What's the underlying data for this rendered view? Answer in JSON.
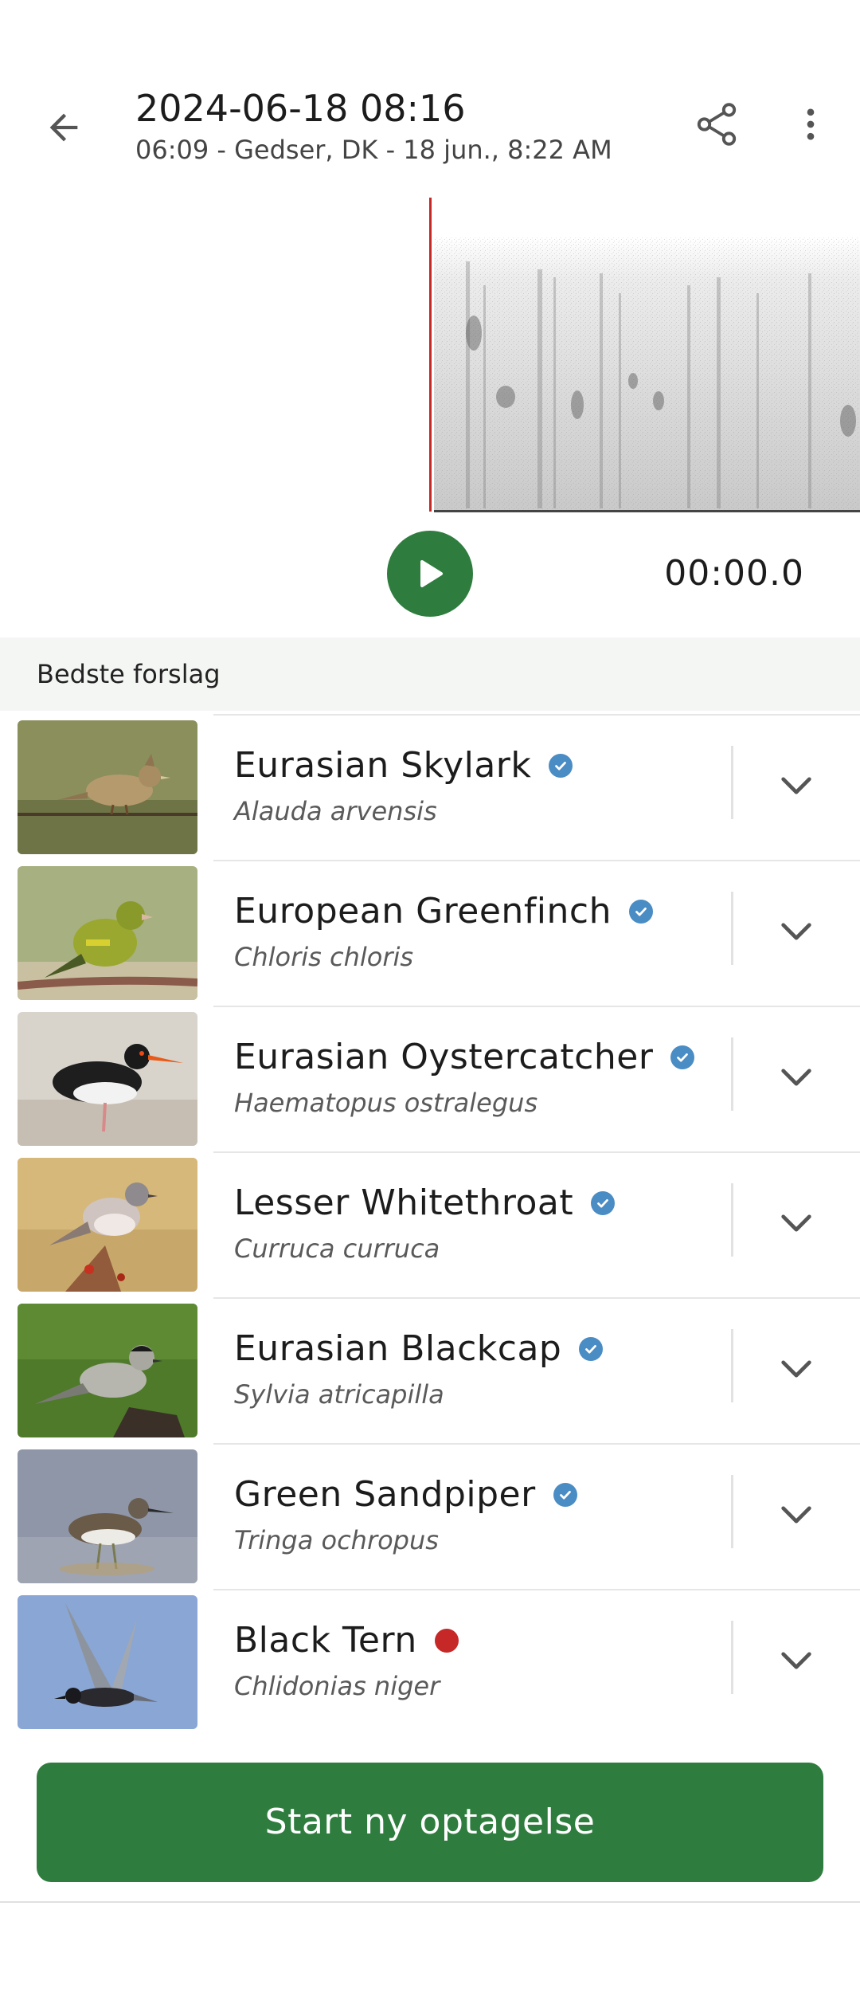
{
  "header": {
    "title": "2024-06-18 08:16",
    "subtitle": "06:09 - Gedser, DK - 18 jun., 8:22 AM",
    "back_icon": "arrow-left-icon",
    "share_icon": "share-icon",
    "menu_icon": "more-vert-icon"
  },
  "player": {
    "time": "00:00.0",
    "play_icon": "play-icon",
    "accent": "#2e7d3e",
    "playhead_color": "#c62828"
  },
  "section": {
    "label": "Bedste forslag"
  },
  "species": [
    {
      "common": "Eurasian Skylark",
      "scientific": "Alauda arvensis",
      "status": "verified"
    },
    {
      "common": "European Greenfinch",
      "scientific": "Chloris chloris",
      "status": "verified"
    },
    {
      "common": "Eurasian Oystercatcher",
      "scientific": "Haematopus ostralegus",
      "status": "verified"
    },
    {
      "common": "Lesser Whitethroat",
      "scientific": "Curruca curruca",
      "status": "verified"
    },
    {
      "common": "Eurasian Blackcap",
      "scientific": "Sylvia atricapilla",
      "status": "verified"
    },
    {
      "common": "Green Sandpiper",
      "scientific": "Tringa ochropus",
      "status": "verified"
    },
    {
      "common": "Black Tern",
      "scientific": "Chlidonias niger",
      "status": "unverified"
    }
  ],
  "colors": {
    "verified_badge": "#4a8cc4",
    "unverified_dot": "#c62828"
  },
  "primary_button": {
    "label": "Start ny optagelse"
  }
}
